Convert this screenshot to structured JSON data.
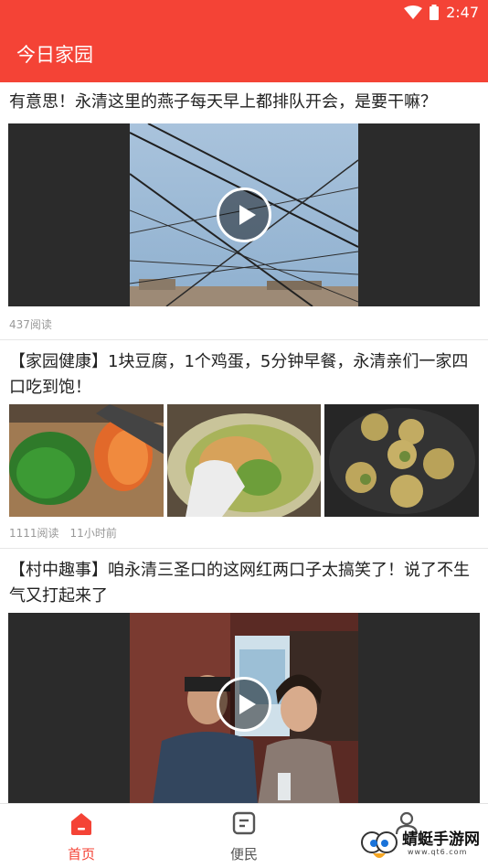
{
  "status_bar": {
    "time": "2:47"
  },
  "app": {
    "title": "今日家园"
  },
  "feed": [
    {
      "title": "有意思！永清这里的燕子每天早上都排队开会，是要干嘛？",
      "reads": "437阅读"
    },
    {
      "title": "【家园健康】1块豆腐，1个鸡蛋，5分钟早餐，永清亲们一家四口吃到饱！",
      "reads": "1111阅读",
      "time": "11小时前"
    },
    {
      "title": "【村中趣事】咱永清三圣口的这网红两口子太搞笑了！说了不生气又打起来了"
    }
  ],
  "bottom_nav": [
    {
      "label": "首页",
      "icon": "home-icon",
      "active": true
    },
    {
      "label": "便民",
      "icon": "document-icon",
      "active": false
    },
    {
      "label": "",
      "icon": "person-icon",
      "active": false
    }
  ],
  "watermark": {
    "text": "蜻蜓手游网",
    "sub": "www.qt6.com"
  },
  "colors": {
    "accent": "#f44336",
    "meta": "#999999"
  }
}
